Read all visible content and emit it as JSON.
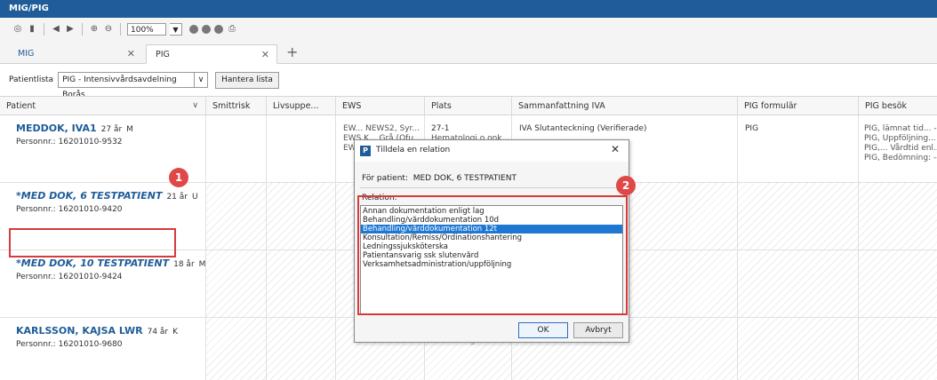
{
  "window": {
    "title": "MIG/PIG"
  },
  "toolbar": {
    "zoom": "100%"
  },
  "tabs": [
    {
      "label": "MIG"
    },
    {
      "label": "PIG"
    }
  ],
  "patientlist": {
    "label": "Patientlista",
    "selected": "PIG - Intensivvårdsavdelning Borås",
    "manage_button": "Hantera lista"
  },
  "columns": [
    "Patient",
    "Smittrisk",
    "Livsuppe...",
    "EWS",
    "Plats",
    "Sammanfattning IVA",
    "PIG formulär",
    "PIG besök"
  ],
  "rows": [
    {
      "name": "MEDDOK, IVA1",
      "age": "27 år",
      "sex": "M",
      "personnr": "Personnr.: 16201010-9532",
      "ews": [
        "EW...  NEWS2, Syr...",
        "EWS K...  Grå (Ofu...",
        "EW..."
      ],
      "plats": [
        "27-1",
        "Hematologi o onk..."
      ],
      "summary": "IVA Slutanteckning (Verifierade)",
      "formular": "PIG",
      "besok": [
        "PIG, lämnat tid...  -",
        "PIG, Uppföljning...",
        "PIG,...  Vårdtid enl..",
        "PIG, Bedömning:  --"
      ]
    },
    {
      "name": "*MED DOK, 6 TESTPATIENT",
      "age": "21 år",
      "sex": "U",
      "personnr": "Personnr.: 16201010-9420"
    },
    {
      "name": "*MED DOK, 10 TESTPATIENT",
      "age": "18 år",
      "sex": "M",
      "personnr": "Personnr.: 16201010-9424"
    },
    {
      "name": "KARLSSON, KAJSA LWR",
      "age": "74 år",
      "sex": "K",
      "personnr": "Personnr.: 16201010-9680",
      "plats_partial": "Hematologi o onk..."
    }
  ],
  "annotations": {
    "badge1": "1",
    "badge2": "2"
  },
  "dialog": {
    "title": "Tilldela en relation",
    "for_patient_label": "För patient:",
    "for_patient_value": "MED DOK, 6 TESTPATIENT",
    "relation_label": "Relation:",
    "options": [
      "Annan dokumentation enligt lag",
      "Behandling/vårddokumentation 10d",
      "Behandling/vårddokumentation 12t",
      "Konsultation/Remiss/Ordinationshantering",
      "Ledningssjuksköterska",
      "Patientansvarig ssk slutenvård",
      "Verksamhetsadministration/uppföljning"
    ],
    "selected_index": 2,
    "ok": "OK",
    "cancel": "Avbryt"
  }
}
